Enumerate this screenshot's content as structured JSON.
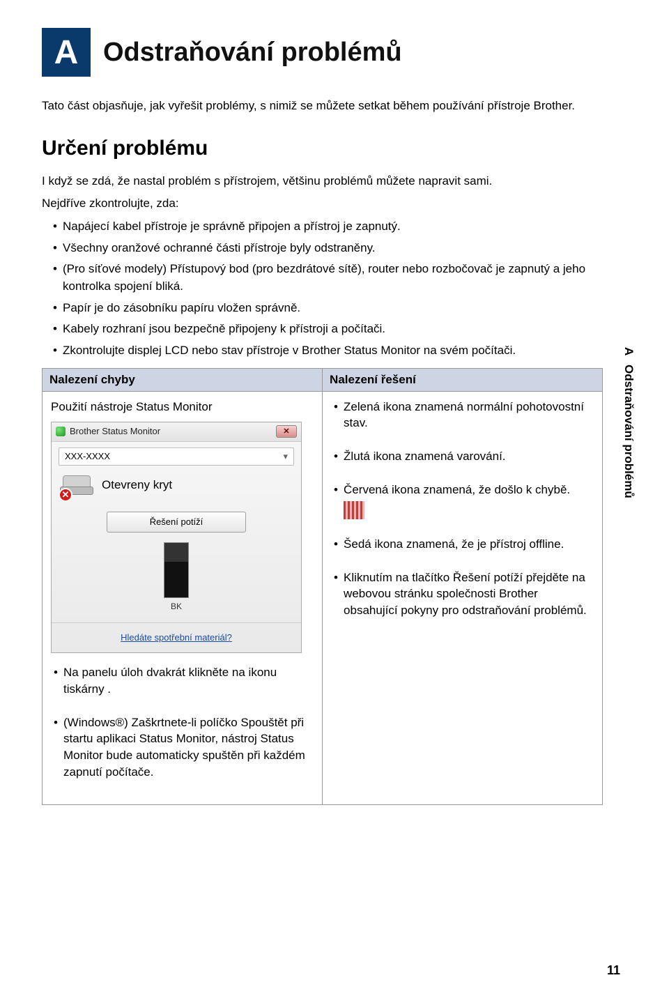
{
  "appendix": {
    "letter": "A",
    "title": "Odstraňování problémů"
  },
  "intro": "Tato část objasňuje, jak vyřešit problémy, s nimiž se můžete setkat během používání přístroje Brother.",
  "section": {
    "title": "Určení problému",
    "lead": "I když se zdá, že nastal problém s přístrojem, většinu problémů můžete napravit sami.",
    "pre": "Nejdříve zkontrolujte, zda:",
    "checks": [
      "Napájecí kabel přístroje je správně připojen a přístroj je zapnutý.",
      "Všechny oranžové ochranné části přístroje byly odstraněny.",
      "(Pro síťové modely) Přístupový bod (pro bezdrátové sítě), router nebo rozbočovač je zapnutý a jeho kontrolka spojení bliká.",
      "Papír je do zásobníku papíru vložen správně.",
      "Kabely rozhraní jsou bezpečně připojeny k přístroji a počítači.",
      "Zkontrolujte displej LCD nebo stav přístroje v Brother Status Monitor na svém počítači."
    ]
  },
  "sideTab": {
    "letter": "A",
    "label": "Odstraňování problémů"
  },
  "table": {
    "th_left": "Nalezení chyby",
    "th_right": "Nalezení řešení",
    "left": {
      "subtitle": "Použití nástroje Status Monitor",
      "bullets": [
        "Na panelu úloh dvakrát klikněte na ikonu tiskárny     .",
        "(Windows®) Zaškrtnete-li políčko Spouštět při startu aplikaci Status Monitor, nástroj Status Monitor bude automaticky spuštěn při každém zapnutí počítače."
      ],
      "sm": {
        "title": "Brother Status Monitor",
        "model": "XXX-XXXX",
        "status": "Otevreny kryt",
        "btn": "Řešení potíží",
        "ink": "BK",
        "footer": "Hledáte spotřební materiál?"
      }
    },
    "right": {
      "items": [
        "Zelená ikona znamená normální pohotovostní stav.",
        "Žlutá ikona znamená varování.",
        "Červená ikona znamená, že došlo k chybě.",
        "Šedá ikona znamená, že je přístroj offline.",
        "Kliknutím na tlačítko Řešení potíží přejděte na webovou stránku společnosti Brother obsahující pokyny pro odstraňování problémů."
      ]
    }
  },
  "pageNumber": "11"
}
